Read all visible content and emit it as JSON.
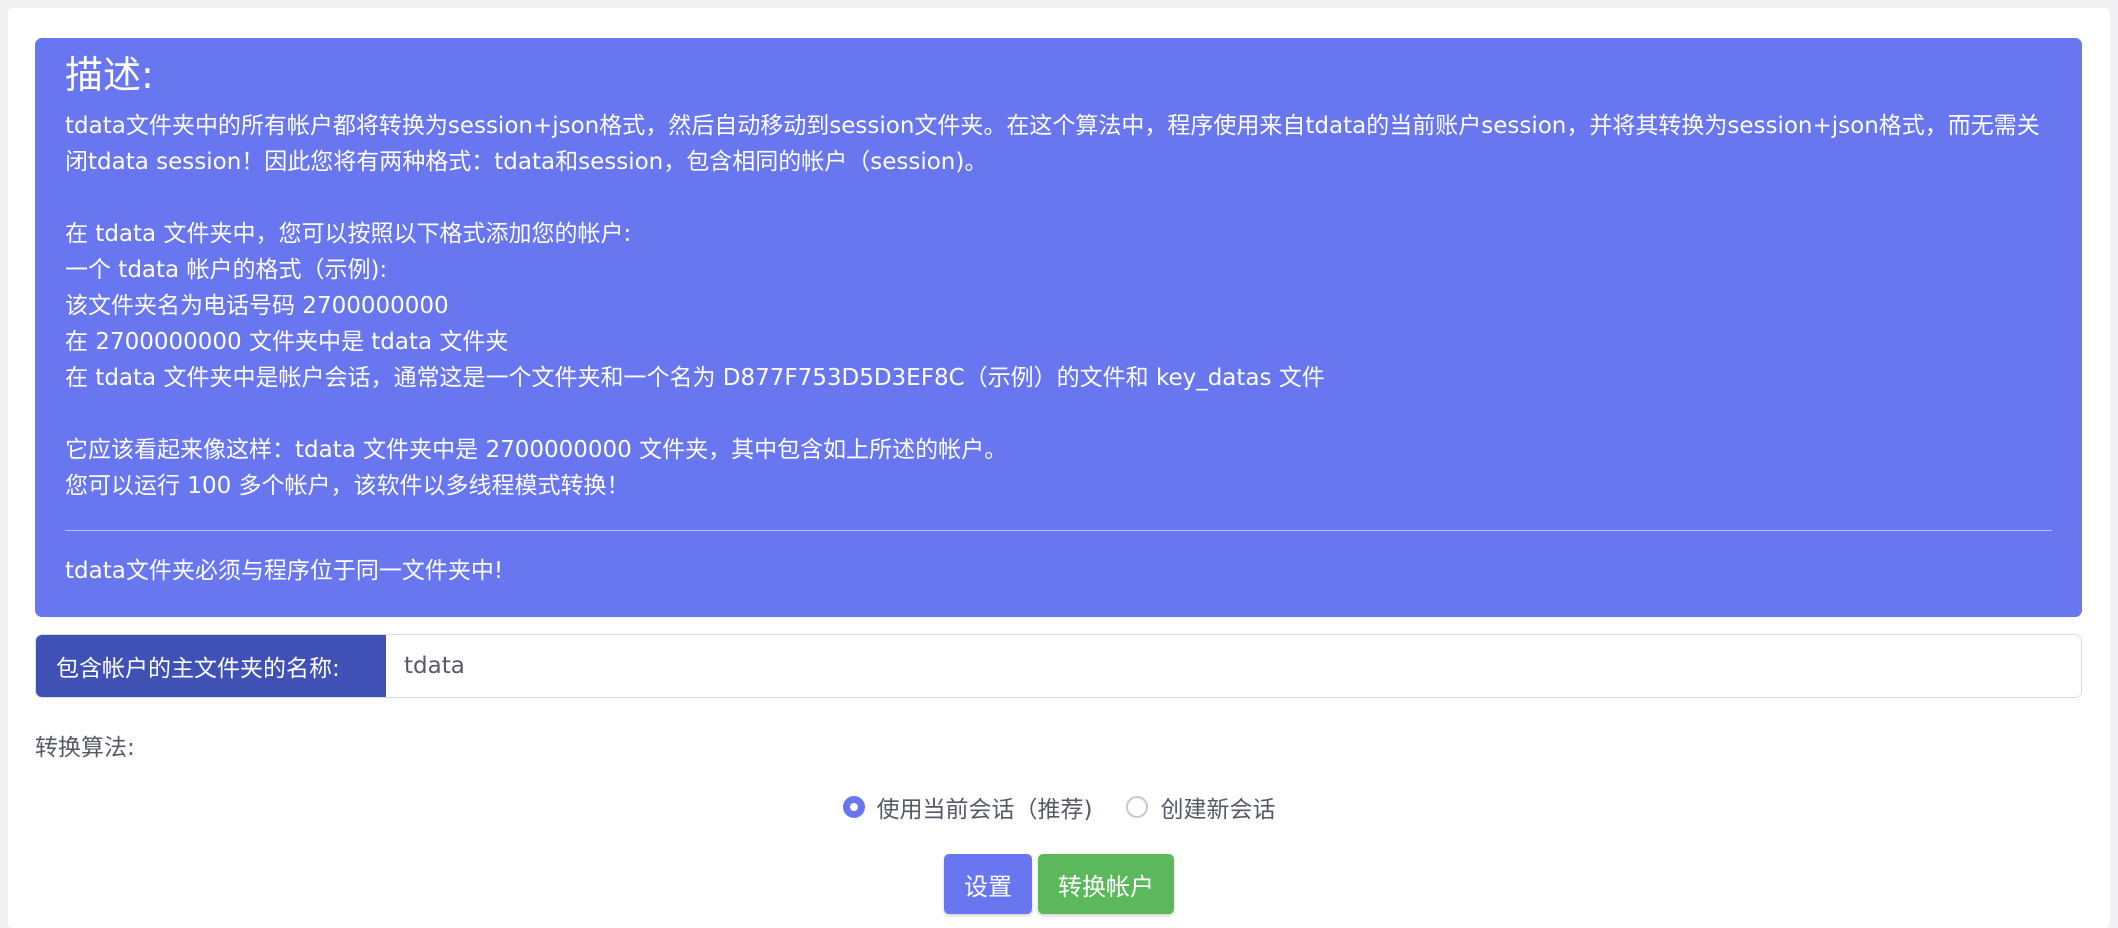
{
  "info": {
    "title": "描述:",
    "paragraph1": "tdata文件夹中的所有帐户都将转换为session+json格式，然后自动移动到session文件夹。在这个算法中，程序使用来自tdata的当前账户session，并将其转换为session+json格式，而无需关闭tdata session！因此您将有两种格式：tdata和session，包含相同的帐户（session)。",
    "format_lines": [
      "在 tdata 文件夹中，您可以按照以下格式添加您的帐户:",
      "一个 tdata 帐户的格式（示例):",
      "该文件夹名为电话号码 2700000000",
      "在 2700000000 文件夹中是 tdata 文件夹",
      "在 tdata 文件夹中是帐户会话，通常这是一个文件夹和一个名为 D877F753D5D3EF8C（示例）的文件和 key_datas 文件"
    ],
    "result_lines": [
      "它应该看起来像这样：tdata 文件夹中是 2700000000 文件夹，其中包含如上所述的帐户。",
      "您可以运行 100 多个帐户，该软件以多线程模式转换！"
    ],
    "footer_note": "tdata文件夹必须与程序位于同一文件夹中!"
  },
  "folder": {
    "label": "包含帐户的主文件夹的名称:",
    "value": "tdata"
  },
  "algorithm": {
    "label": "转换算法:",
    "options": [
      {
        "label": "使用当前会话（推荐)",
        "checked": true
      },
      {
        "label": "创建新会话",
        "checked": false
      }
    ]
  },
  "buttons": {
    "settings": "设置",
    "convert": "转换帐户"
  },
  "colors": {
    "info_bg": "#6877ef",
    "label_bg": "#3f51b5",
    "settings_btn": "#6877ef",
    "convert_btn": "#5cb85c"
  }
}
